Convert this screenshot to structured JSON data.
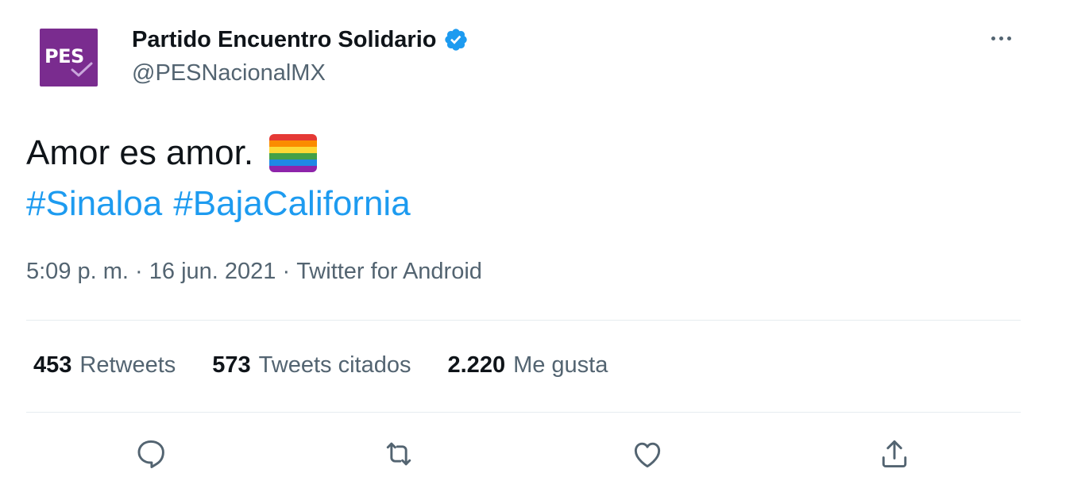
{
  "avatar": {
    "logo_text": "PES",
    "color": "#7a2c8f"
  },
  "user": {
    "display_name": "Partido Encuentro Solidario",
    "handle": "@PESNacionalMX",
    "verified_color": "#1d9bf0"
  },
  "tweet": {
    "text": "Amor es amor.",
    "emoji": "rainbow-flag-emoji",
    "hashtags": [
      "#Sinaloa",
      "#BajaCalifornia"
    ],
    "time": "5:09 p. m.",
    "separator": " · ",
    "date": "16 jun. 2021",
    "source": "Twitter for Android"
  },
  "stats": [
    {
      "count": "453",
      "label": "Retweets"
    },
    {
      "count": "573",
      "label": "Tweets citados"
    },
    {
      "count": "2.220",
      "label": "Me gusta"
    }
  ],
  "actions": [
    "reply-icon",
    "retweet-icon",
    "like-icon",
    "share-icon"
  ],
  "colors": {
    "link": "#1d9bf0",
    "secondary_text": "#536471",
    "primary_text": "#0f1419"
  }
}
